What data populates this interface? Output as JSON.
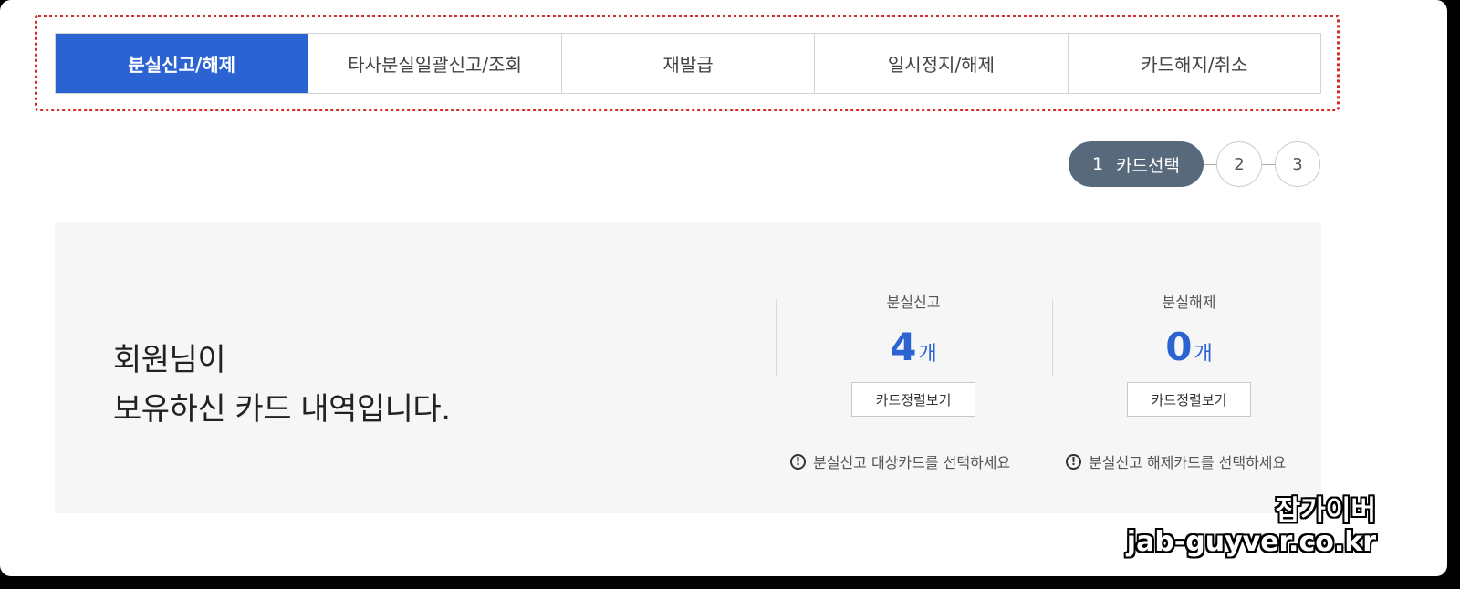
{
  "tabs": [
    {
      "label": "분실신고/해제",
      "active": true
    },
    {
      "label": "타사분실일괄신고/조회",
      "active": false
    },
    {
      "label": "재발급",
      "active": false
    },
    {
      "label": "일시정지/해제",
      "active": false
    },
    {
      "label": "카드해지/취소",
      "active": false
    }
  ],
  "steps": {
    "current_number": "1",
    "current_label": "카드선택",
    "step2": "2",
    "step3": "3"
  },
  "intro": {
    "line1": "회원님이",
    "line2": "보유하신 카드 내역입니다."
  },
  "stats": {
    "report": {
      "label": "분실신고",
      "value": "4",
      "unit": "개",
      "button": "카드정렬보기",
      "notice": "분실신고 대상카드를 선택하세요"
    },
    "release": {
      "label": "분실해제",
      "value": "0",
      "unit": "개",
      "button": "카드정렬보기",
      "notice": "분실신고 해제카드를 선택하세요"
    }
  },
  "notice_icon": "!",
  "watermark": {
    "line1": "잡가이버",
    "line2": "jab-guyver.co.kr"
  },
  "colors": {
    "accent": "#2b63d3",
    "step_active": "#58697b",
    "highlight_border": "#d52a2a"
  }
}
